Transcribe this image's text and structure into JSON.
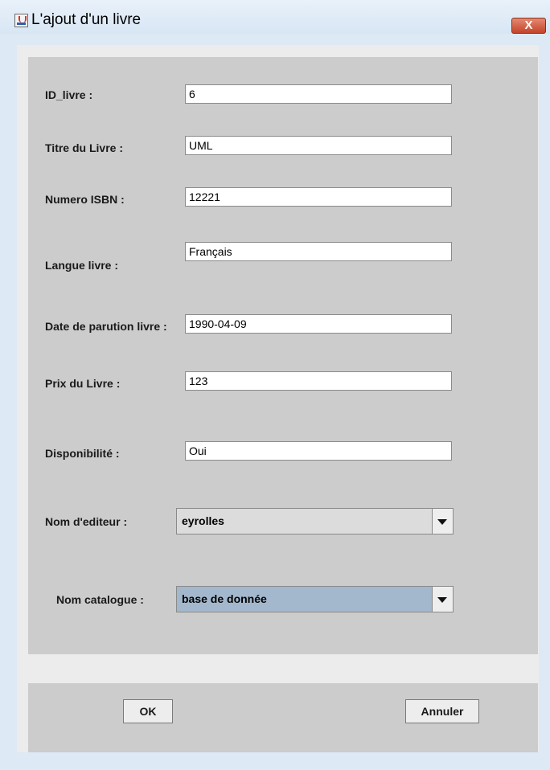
{
  "window": {
    "title": "L'ajout d'un livre",
    "close_label": "X"
  },
  "form": {
    "fields": [
      {
        "label": "ID_livre :",
        "value": "6"
      },
      {
        "label": "Titre du Livre :",
        "value": "UML"
      },
      {
        "label": "Numero ISBN :",
        "value": "12221"
      },
      {
        "label": "Langue livre :",
        "value": "Français"
      },
      {
        "label": "Date de parution livre :",
        "value": "1990-04-09"
      },
      {
        "label": "Prix du Livre :",
        "value": "123"
      },
      {
        "label": "Disponibilité :",
        "value": "Oui"
      }
    ],
    "editeur": {
      "label": "Nom d'editeur :",
      "selected": "eyrolles"
    },
    "catalogue": {
      "label": "Nom catalogue :",
      "selected": "base de donnée"
    }
  },
  "buttons": {
    "ok": "OK",
    "cancel": "Annuler"
  },
  "colors": {
    "window_frame": "#dde9f5",
    "panel": "#cccccc",
    "close_button": "#c3432a",
    "catalogue_selected": "#a3b8cc"
  }
}
